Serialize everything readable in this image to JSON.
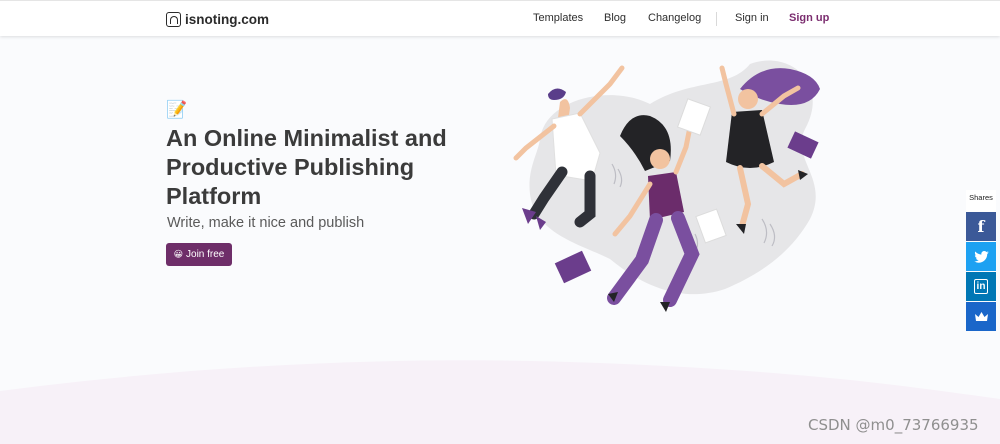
{
  "header": {
    "logo_text": "isnoting.com",
    "nav": [
      {
        "label": "Templates"
      },
      {
        "label": "Blog"
      },
      {
        "label": "Changelog"
      },
      {
        "label": "Sign in"
      },
      {
        "label": "Sign up"
      }
    ]
  },
  "hero": {
    "icon": "📝",
    "title": "An Online Minimalist and Productive Publishing Platform",
    "subtitle": "Write, make it nice and publish",
    "cta_emoji": "😀",
    "cta_label": "Join free"
  },
  "share": {
    "label": "Shares",
    "buttons": [
      "facebook-icon",
      "twitter-icon",
      "linkedin-icon",
      "sumo-crown-icon"
    ]
  },
  "watermark": "CSDN @m0_73766935",
  "colors": {
    "accent": "#6e2e69",
    "signup": "#7b2d6f",
    "facebook": "#3b5998",
    "twitter": "#1da1f2",
    "linkedin": "#0077b5",
    "sumo": "#1a66c9",
    "illustration_purple": "#7a4f9f",
    "illustration_blob": "#e6e6e8"
  }
}
